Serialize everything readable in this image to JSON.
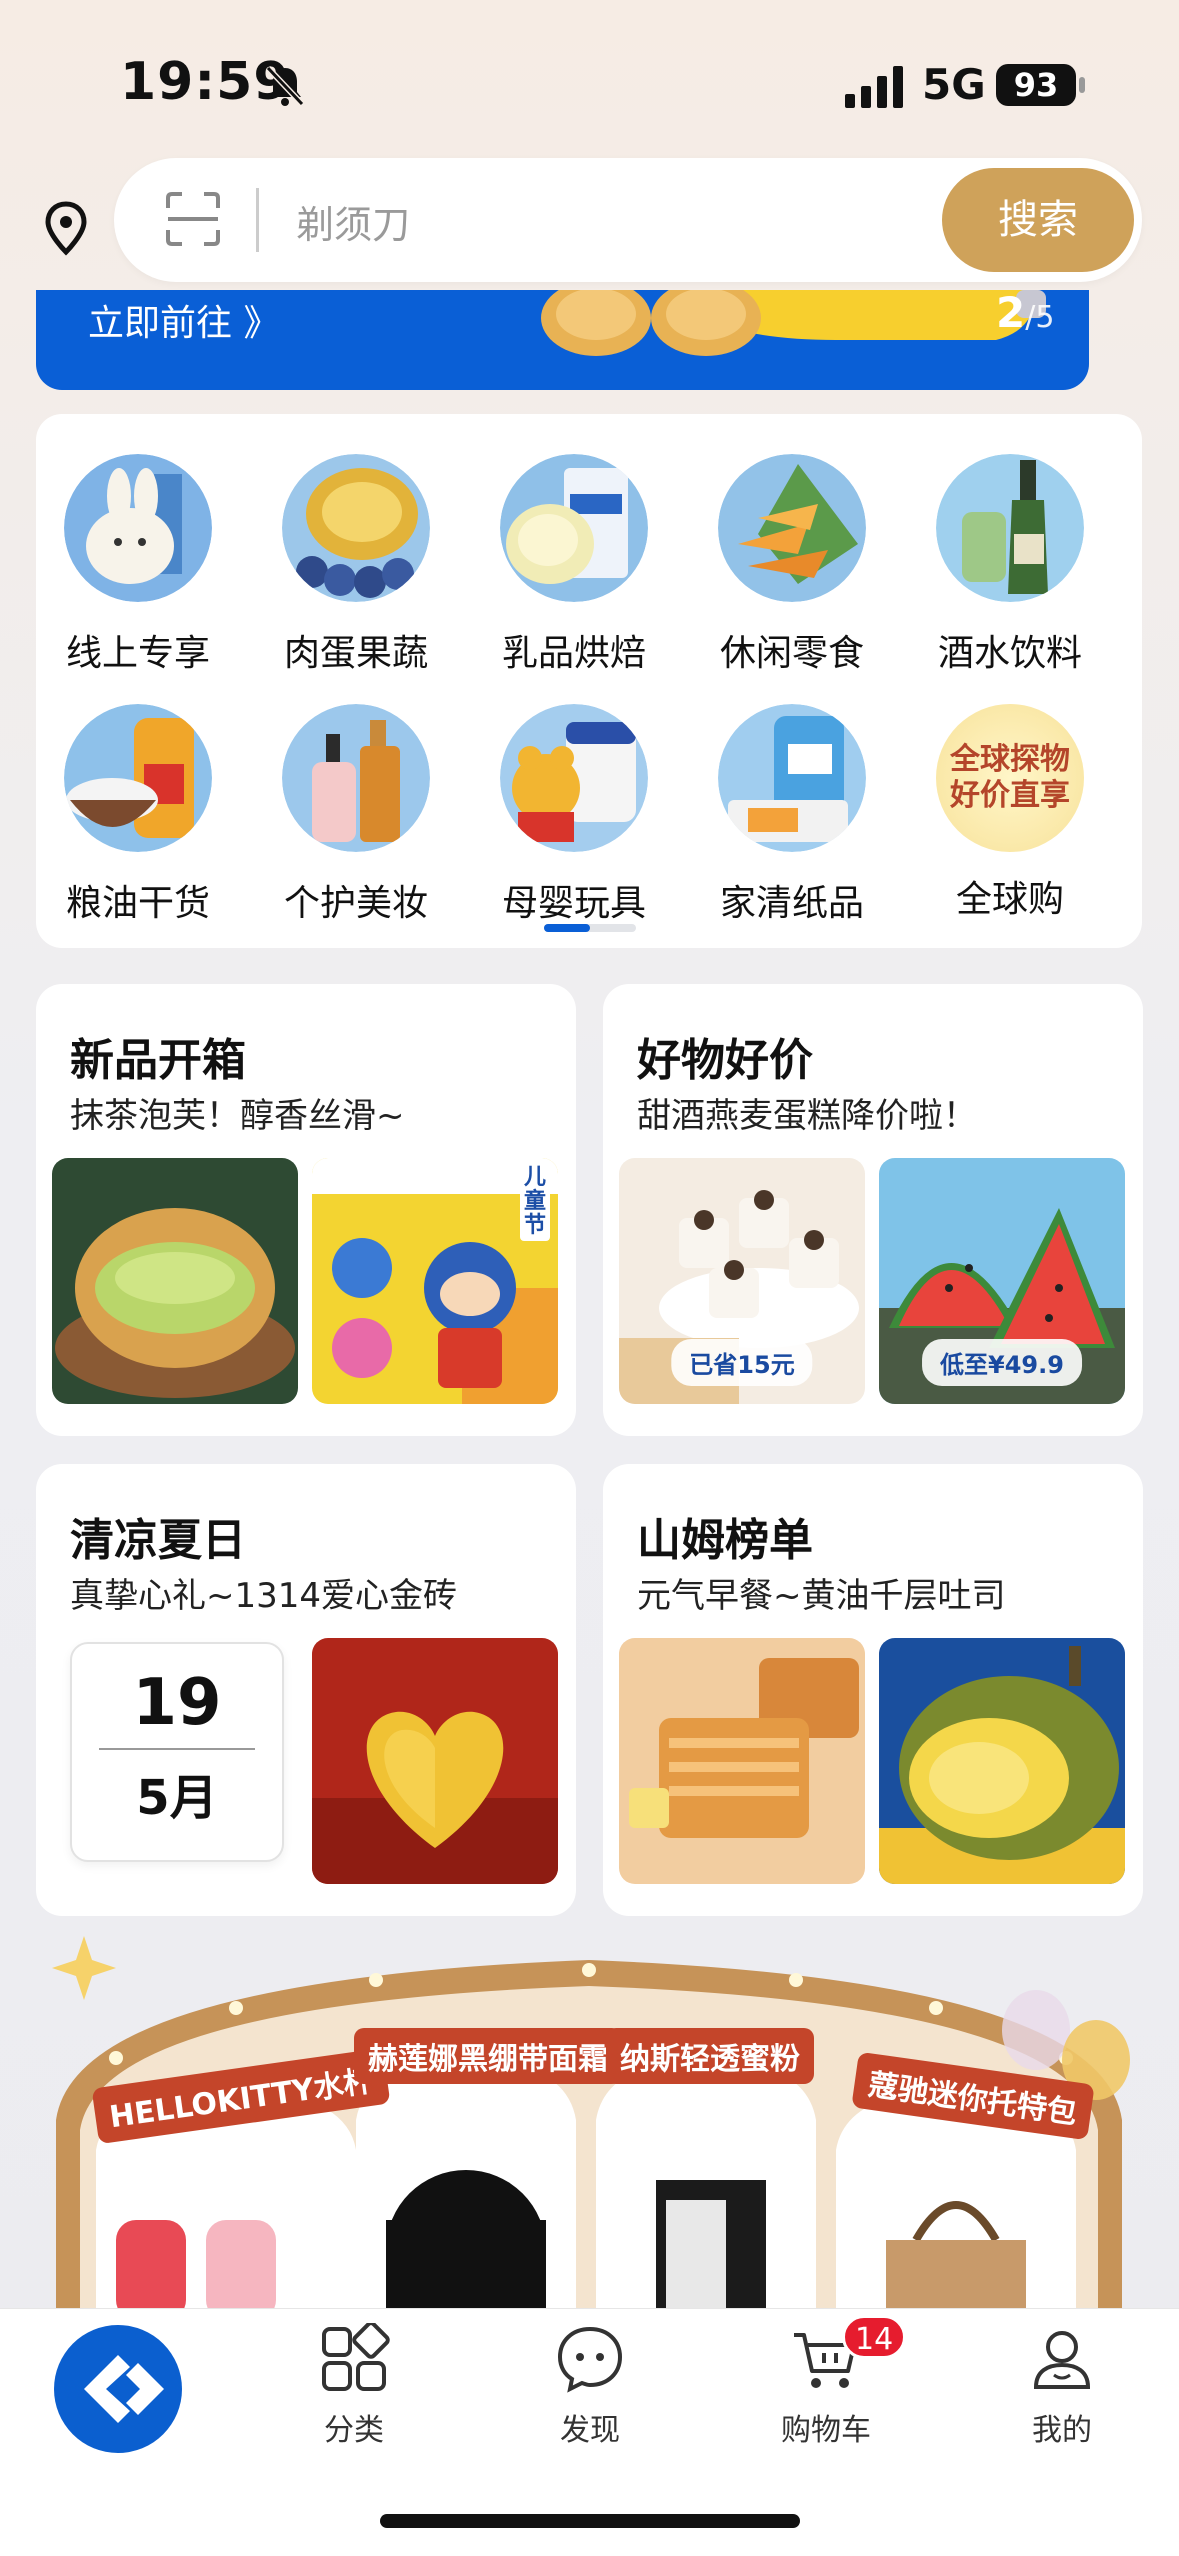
{
  "status_bar": {
    "time": "19:59",
    "network": "5G",
    "battery": "93"
  },
  "search": {
    "placeholder": "剃须刀",
    "button_label": "搜索"
  },
  "banner": {
    "link_label": "立即前往 》",
    "page_current": "2",
    "page_total": "/5"
  },
  "categories": [
    {
      "label": "线上专享"
    },
    {
      "label": "肉蛋果蔬"
    },
    {
      "label": "乳品烘焙"
    },
    {
      "label": "休闲零食"
    },
    {
      "label": "酒水饮料"
    },
    {
      "label": "粮油干货"
    },
    {
      "label": "个护美妆"
    },
    {
      "label": "母婴玩具"
    },
    {
      "label": "家清纸品"
    },
    {
      "label": "全球购",
      "badge_text": "全球探物好价直享"
    }
  ],
  "promos": {
    "new_items": {
      "title": "新品开箱",
      "subtitle": "抹茶泡芙！醇香丝滑~",
      "toy_badge": "儿童节"
    },
    "good_price": {
      "title": "好物好价",
      "subtitle": "甜酒燕麦蛋糕降价啦！",
      "tag_left": "已省15元",
      "tag_right": "低至¥49.9"
    },
    "summer": {
      "title": "清凉夏日",
      "subtitle": "真挚心礼~1314爱心金砖",
      "calendar_day": "19",
      "calendar_month": "5月"
    },
    "sams_rank": {
      "title": "山姆榜单",
      "subtitle": "元气早餐~黄油千层吐司"
    }
  },
  "showcase": {
    "items": [
      {
        "label": "HELLOKITTY水杯"
      },
      {
        "label": "赫莲娜黑绷带面霜"
      },
      {
        "label": "纳斯轻透蜜粉"
      },
      {
        "label": "蔻驰迷你托特包"
      }
    ]
  },
  "tab_bar": {
    "tabs": [
      {
        "label": "分类"
      },
      {
        "label": "发现"
      },
      {
        "label": "购物车",
        "badge": "14"
      },
      {
        "label": "我的"
      }
    ]
  },
  "colors": {
    "accent_gold": "#cfa25a",
    "brand_blue": "#0a5fd6",
    "badge_red": "#e61c2e"
  }
}
